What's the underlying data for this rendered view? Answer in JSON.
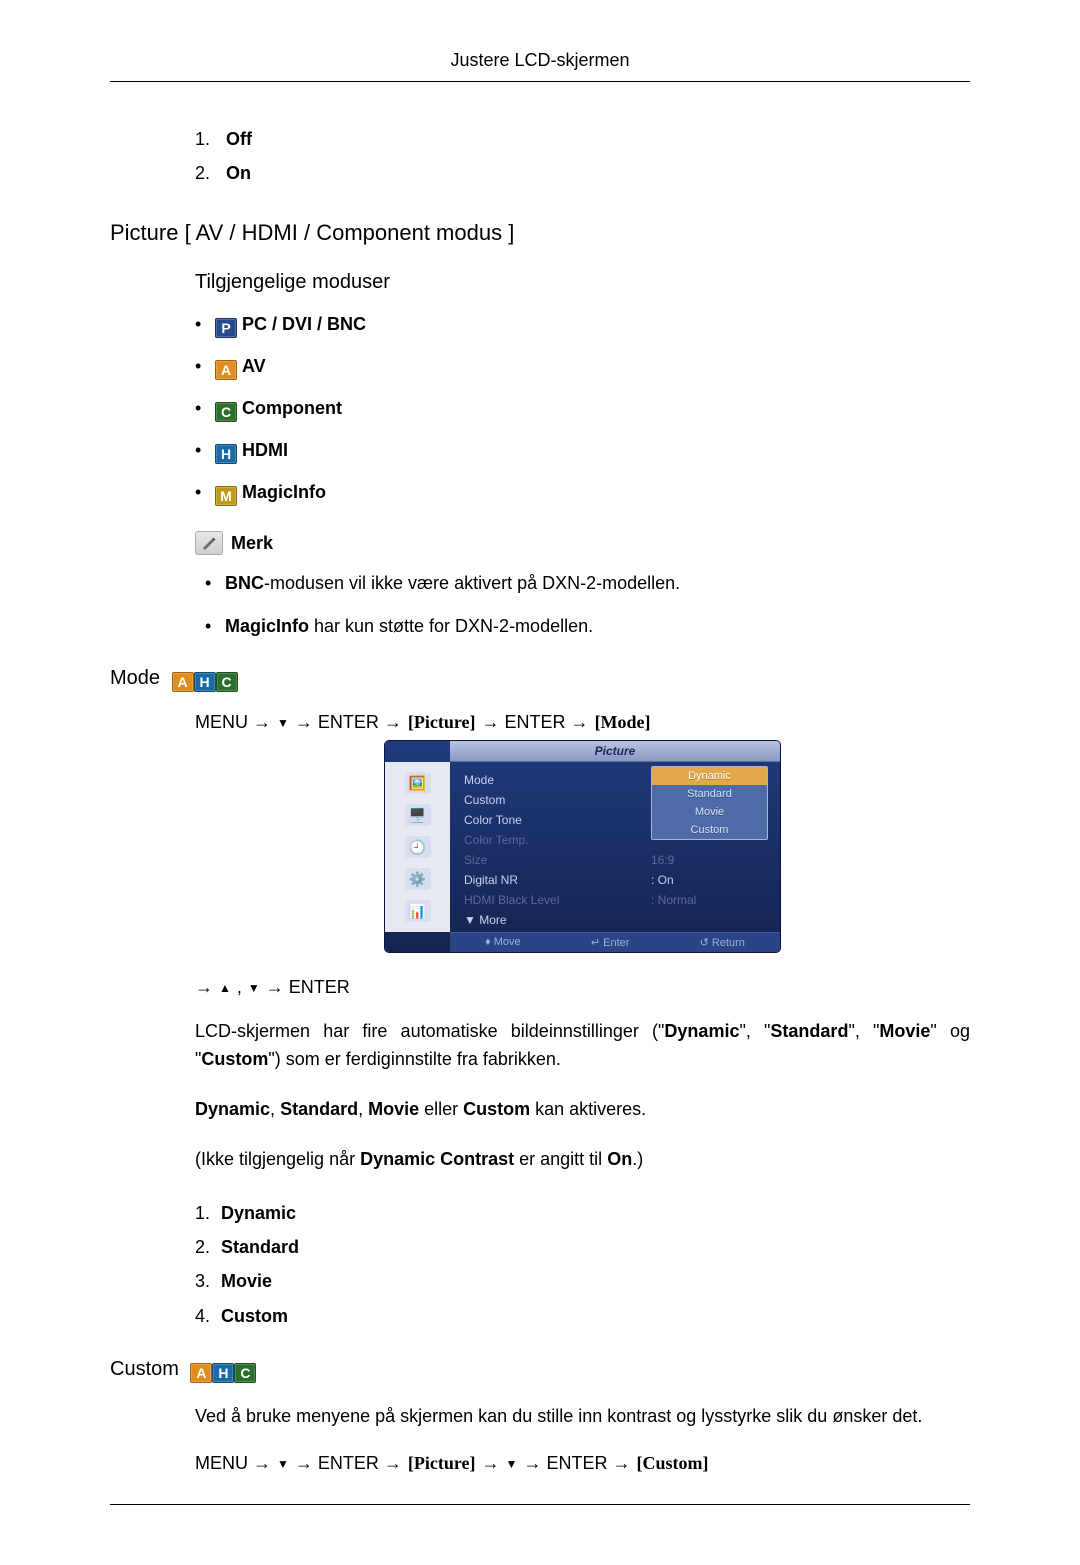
{
  "header": {
    "title": "Justere LCD-skjermen"
  },
  "top_list": [
    {
      "num": "1.",
      "label": "Off"
    },
    {
      "num": "2.",
      "label": "On"
    }
  ],
  "picture_section": {
    "heading": "Picture [ AV / HDMI / Component modus ]",
    "modes_heading": "Tilgjengelige moduser",
    "modes": [
      {
        "badge": "P",
        "label": "PC / DVI / BNC"
      },
      {
        "badge": "A",
        "label": "AV"
      },
      {
        "badge": "C",
        "label": "Component"
      },
      {
        "badge": "H",
        "label": "HDMI"
      },
      {
        "badge": "M",
        "label": "MagicInfo"
      }
    ],
    "note_label": "Merk",
    "notes": [
      {
        "bold": "BNC",
        "rest": "-modusen vil ikke være aktivert på DXN-2-modellen."
      },
      {
        "bold": "MagicInfo",
        "rest": " har kun støtte for DXN-2-modellen."
      }
    ]
  },
  "mode_section": {
    "heading": "Mode",
    "badges": [
      "A",
      "H",
      "C"
    ],
    "nav": {
      "pre": "MENU → ",
      "enter1": " → ENTER → ",
      "pic": "[Picture]",
      "mid": " → ENTER → ",
      "mode": "[Mode]"
    },
    "osd": {
      "title": "Picture",
      "rows": [
        {
          "label": "Mode",
          "value": ":",
          "dim": false
        },
        {
          "label": "Custom",
          "value": "",
          "dim": false
        },
        {
          "label": "Color Tone",
          "value": ":",
          "dim": false
        },
        {
          "label": "Color Temp.",
          "value": "",
          "dim": true
        },
        {
          "label": "Size",
          "value": "16:9",
          "dim": true
        },
        {
          "label": "Digital NR",
          "value": ": On",
          "dim": false
        },
        {
          "label": "HDMI Black Level",
          "value": ": Normal",
          "dim": true
        }
      ],
      "more": "More",
      "options": [
        "Dynamic",
        "Standard",
        "Movie",
        "Custom"
      ],
      "selected_option_index": 0,
      "footer": {
        "move": "Move",
        "enter": "Enter",
        "return": "Return"
      }
    },
    "nav2": {
      "pre": "→ ",
      "mid": " , ",
      "post": " → ENTER"
    },
    "para1_a": "LCD-skjermen har fire automatiske bildeinnstillinger (\"",
    "para1_b": "Dynamic",
    "para1_c": "\", \"",
    "para1_d": "Standard",
    "para1_e": "\", \"",
    "para1_f": "Movie",
    "para1_g": "\" og \"",
    "para1_h": "Custom",
    "para1_i": "\") som er ferdiginnstilte fra fabrikken.",
    "para2_pre": "",
    "para2_b1": "Dynamic",
    "para2_c1": ", ",
    "para2_b2": "Standard",
    "para2_c2": ", ",
    "para2_b3": "Movie",
    "para2_c3": " eller ",
    "para2_b4": "Custom",
    "para2_end": " kan aktiveres.",
    "para3_a": "(Ikke tilgjengelig når ",
    "para3_b": "Dynamic Contrast",
    "para3_c": " er angitt til ",
    "para3_d": "On",
    "para3_e": ".)",
    "enum": [
      {
        "num": "1.",
        "label": "Dynamic"
      },
      {
        "num": "2.",
        "label": "Standard"
      },
      {
        "num": "3.",
        "label": "Movie"
      },
      {
        "num": "4.",
        "label": "Custom"
      }
    ]
  },
  "custom_section": {
    "heading": "Custom",
    "badges": [
      "A",
      "H",
      "C"
    ],
    "para": "Ved å bruke menyene på skjermen kan du stille inn kontrast og lysstyrke slik du ønsker det.",
    "nav": {
      "pre": "MENU → ",
      "enter1": " → ENTER → ",
      "pic": "[Picture]",
      "mid1": " → ",
      "mid2": " → ENTER → ",
      "cust": "[Custom]"
    }
  }
}
